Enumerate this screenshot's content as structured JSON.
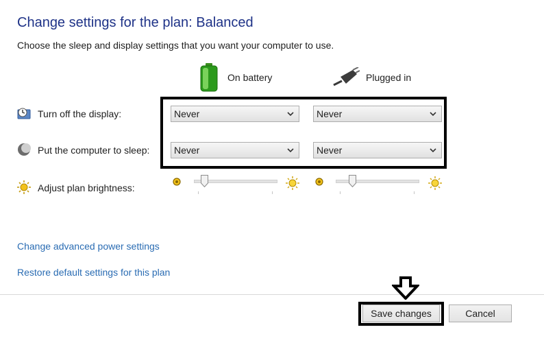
{
  "header": {
    "title": "Change settings for the plan: Balanced",
    "subtitle": "Choose the sleep and display settings that you want your computer to use."
  },
  "columns": {
    "battery": {
      "label": "On battery",
      "icon": "battery-icon"
    },
    "plugged": {
      "label": "Plugged in",
      "icon": "plug-icon"
    }
  },
  "rows": {
    "display": {
      "label": "Turn off the display:",
      "icon": "display-timer-icon",
      "battery_value": "Never",
      "plugged_value": "Never"
    },
    "sleep": {
      "label": "Put the computer to sleep:",
      "icon": "sleep-moon-icon",
      "battery_value": "Never",
      "plugged_value": "Never"
    },
    "brightness": {
      "label": "Adjust plan brightness:",
      "icon": "brightness-icon",
      "battery_level": 0.13,
      "plugged_level": 0.2
    }
  },
  "links": {
    "advanced": "Change advanced power settings",
    "restore": "Restore default settings for this plan"
  },
  "buttons": {
    "save": "Save changes",
    "cancel": "Cancel"
  },
  "colors": {
    "title": "#1e3287",
    "link": "#2a6cb3",
    "highlight": "#000000"
  }
}
